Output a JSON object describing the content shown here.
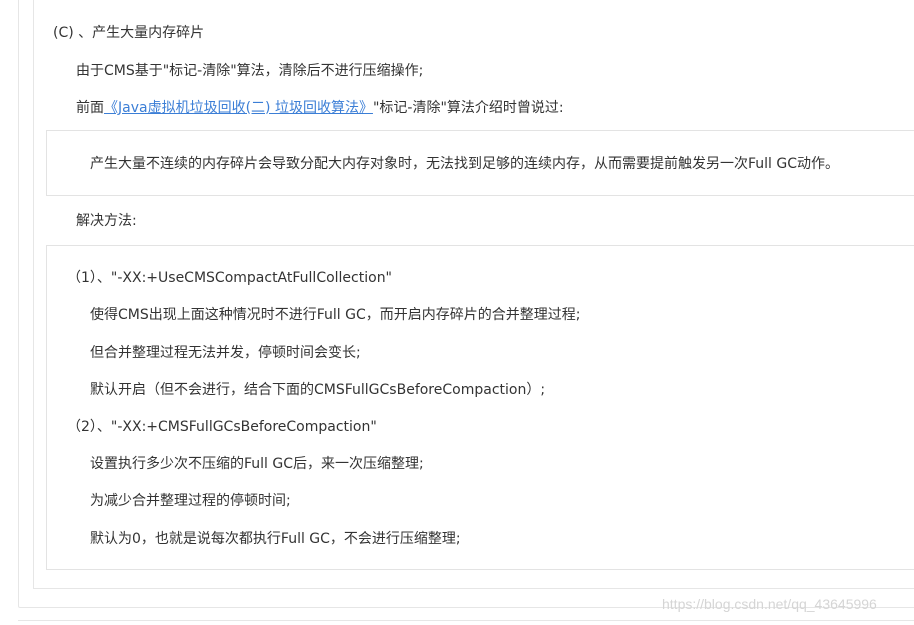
{
  "heading": "(C) 、产生大量内存碎片",
  "line1": "由于CMS基于\"标记-清除\"算法，清除后不进行压缩操作;",
  "line2": {
    "prefix": "前面",
    "link_text": "《Java虚拟机垃圾回收(二) 垃圾回收算法》",
    "suffix": "\"标记-清除\"算法介绍时曾说过:"
  },
  "quote": "产生大量不连续的内存碎片会导致分配大内存对象时，无法找到足够的连续内存，从而需要提前触发另一次Full GC动作。",
  "solution_label": "解决方法:",
  "solutions": [
    {
      "title": "（1）、\"-XX:+UseCMSCompactAtFullCollection\"",
      "lines": [
        "使得CMS出现上面这种情况时不进行Full GC，而开启内存碎片的合并整理过程;",
        "但合并整理过程无法并发，停顿时间会变长;",
        "默认开启（但不会进行，结合下面的CMSFullGCsBeforeCompaction）;"
      ]
    },
    {
      "title": "（2）、\"-XX:+CMSFullGCsBeforeCompaction\"",
      "lines": [
        "设置执行多少次不压缩的Full GC后，来一次压缩整理;",
        "为减少合并整理过程的停顿时间;",
        "默认为0，也就是说每次都执行Full GC，不会进行压缩整理;"
      ]
    }
  ],
  "watermark": "https://blog.csdn.net/qq_43645996",
  "colors": {
    "link": "#3b7ed6",
    "text": "#333333",
    "border": "#e3e3e3"
  }
}
